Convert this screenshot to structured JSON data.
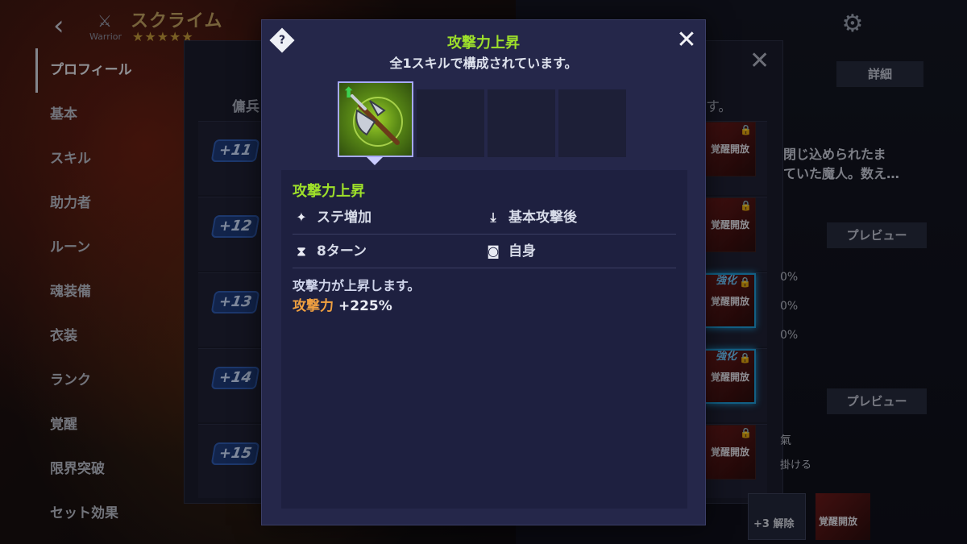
{
  "header": {
    "back_icon": "chevron-left-icon",
    "class_label": "Warrior",
    "hero_name": "スクライム",
    "stars": "★★★★★"
  },
  "menu": {
    "items": [
      {
        "label": "プロフィール",
        "active": true
      },
      {
        "label": "基本"
      },
      {
        "label": "スキル"
      },
      {
        "label": "助力者"
      },
      {
        "label": "ルーン"
      },
      {
        "label": "魂装備"
      },
      {
        "label": "衣装"
      },
      {
        "label": "ランク"
      },
      {
        "label": "覚醒"
      },
      {
        "label": "限界突破"
      },
      {
        "label": "セット効果"
      }
    ]
  },
  "under_panel": {
    "column_left": "傭兵",
    "column_right": "す。",
    "detail_tab": "詳細",
    "description": "閉じ込められたま\nていた魔人。数え…",
    "preview_1": "プレビュー",
    "preview_2": "プレビュー",
    "percents": [
      "0%",
      "0%",
      "0%"
    ],
    "tail_1": "氣",
    "tail_2": "掛ける",
    "levels": [
      {
        "badge": "+11",
        "card": "覚醒開放"
      },
      {
        "badge": "+12",
        "card": "覚醒開放"
      },
      {
        "badge": "+13",
        "card": "覚醒開放",
        "enhance": "強化"
      },
      {
        "badge": "+14",
        "card": "覚醒開放",
        "enhance": "強化"
      },
      {
        "badge": "+15",
        "card": "覚醒開放"
      }
    ],
    "bottom_card_1": "+3 解除",
    "bottom_card_2": "覚醒開放"
  },
  "popup": {
    "help_label": "?",
    "title": "攻撃力上昇",
    "subtitle": "全1スキルで構成されています。",
    "close_icon": "close-icon",
    "skill": {
      "name": "攻撃力上昇",
      "type": "ステ増加",
      "timing": "基本攻撃後",
      "duration": "8ターン",
      "target": "自身",
      "description": "攻撃力が上昇します。",
      "effect_name": "攻撃力",
      "effect_value": "+225%"
    }
  },
  "colors": {
    "title_green": "#9ee02a",
    "effect_orange": "#f0a040",
    "popup_bg": "#25274a"
  }
}
